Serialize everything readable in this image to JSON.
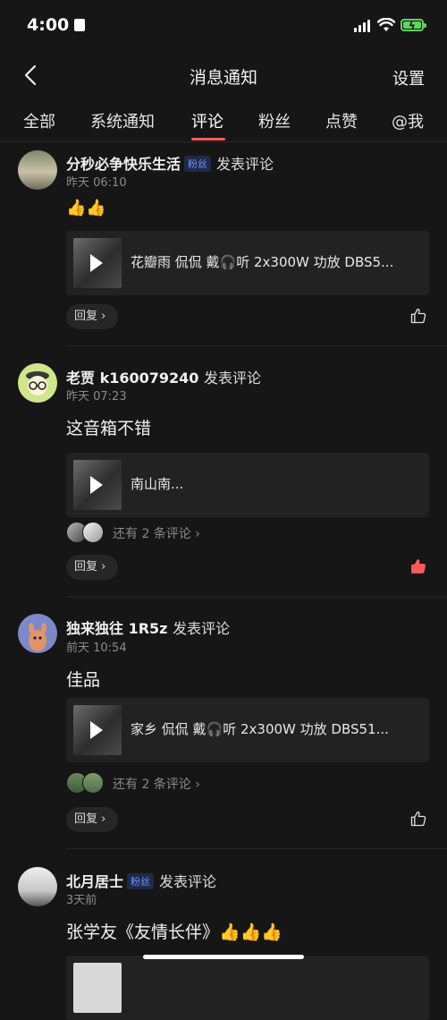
{
  "status_bar": {
    "time": "4:00"
  },
  "nav": {
    "title": "消息通知",
    "settings_label": "设置"
  },
  "tabs": [
    {
      "label": "全部"
    },
    {
      "label": "系统通知"
    },
    {
      "label": "评论",
      "active": true
    },
    {
      "label": "粉丝"
    },
    {
      "label": "点赞"
    },
    {
      "label": "@我"
    }
  ],
  "comments": [
    {
      "name": "分秒必争快乐生活",
      "badge": "粉丝",
      "action": "发表评论",
      "time": "昨天 06:10",
      "body": "👍👍",
      "preview": "花瓣雨 侃侃 戴🎧听 2x300W 功放 DBS5...",
      "reply_label": "回复 ›",
      "liked": false
    },
    {
      "name": "老贾 k160079240",
      "badge": "",
      "action": "发表评论",
      "time": "昨天 07:23",
      "body": "这音箱不错",
      "preview": "南山南...",
      "more": "还有 2 条评论 ›",
      "reply_label": "回复 ›",
      "liked": true
    },
    {
      "name": "独来独往 1R5z",
      "badge": "",
      "action": "发表评论",
      "time": "前天 10:54",
      "body": "佳品",
      "preview": "家乡 侃侃 戴🎧听 2x300W 功放 DBS51...",
      "more": "还有 2 条评论 ›",
      "reply_label": "回复 ›",
      "liked": false
    },
    {
      "name": "北月居士",
      "badge": "粉丝",
      "action": "发表评论",
      "time": "3天前",
      "body": "张学友《友情长伴》👍👍👍"
    }
  ],
  "colors": {
    "accent": "#ff5a5a",
    "badge_text": "#6f8fff",
    "background": "#161616"
  }
}
